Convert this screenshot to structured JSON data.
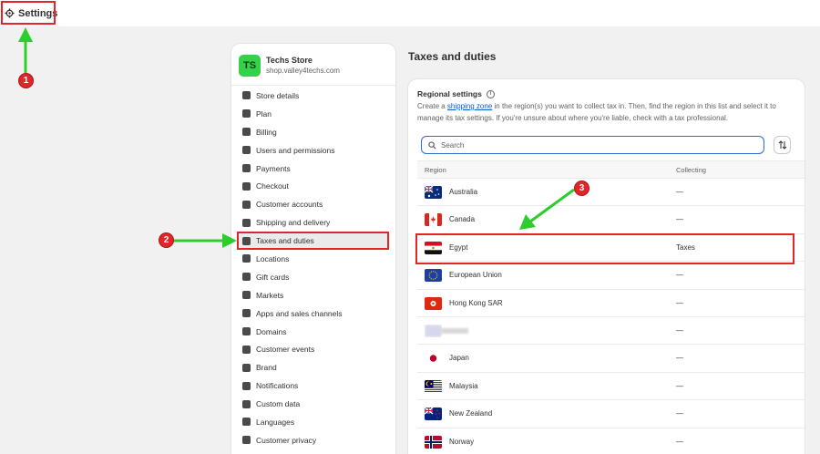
{
  "header": {
    "title": "Settings",
    "icon": "gear-icon"
  },
  "annotations": {
    "step1": "1",
    "step2": "2",
    "step3": "3",
    "color": "#e0262b",
    "arrow_color": "#2ecc2e"
  },
  "store": {
    "initials": "TS",
    "name": "Techs Store",
    "url": "shop.valley4techs.com",
    "avatar_color": "#35d14b"
  },
  "sidebar": {
    "items": [
      {
        "label": "Store details",
        "icon": "store-icon"
      },
      {
        "label": "Plan",
        "icon": "plan-icon"
      },
      {
        "label": "Billing",
        "icon": "billing-icon"
      },
      {
        "label": "Users and permissions",
        "icon": "users-icon"
      },
      {
        "label": "Payments",
        "icon": "payments-icon"
      },
      {
        "label": "Checkout",
        "icon": "checkout-icon"
      },
      {
        "label": "Customer accounts",
        "icon": "customer-icon"
      },
      {
        "label": "Shipping and delivery",
        "icon": "truck-icon"
      },
      {
        "label": "Taxes and duties",
        "icon": "tax-icon",
        "active": true
      },
      {
        "label": "Locations",
        "icon": "location-icon"
      },
      {
        "label": "Gift cards",
        "icon": "gift-icon"
      },
      {
        "label": "Markets",
        "icon": "globe-icon"
      },
      {
        "label": "Apps and sales channels",
        "icon": "apps-icon"
      },
      {
        "label": "Domains",
        "icon": "domain-icon"
      },
      {
        "label": "Customer events",
        "icon": "events-icon"
      },
      {
        "label": "Brand",
        "icon": "brand-icon"
      },
      {
        "label": "Notifications",
        "icon": "bell-icon"
      },
      {
        "label": "Custom data",
        "icon": "data-icon"
      },
      {
        "label": "Languages",
        "icon": "language-icon"
      },
      {
        "label": "Customer privacy",
        "icon": "privacy-icon"
      }
    ]
  },
  "main": {
    "title": "Taxes and duties",
    "card": {
      "heading": "Regional settings",
      "desc_before": "Create a ",
      "desc_link": "shipping zone",
      "desc_after": " in the region(s) you want to collect tax in. Then, find the region in this list and select it to manage its tax settings. If you're unsure about where you're liable, check with a tax professional.",
      "search_placeholder": "Search",
      "col_region": "Region",
      "col_collecting": "Collecting",
      "rows": [
        {
          "name": "Australia",
          "collecting": "—",
          "flag": "australia"
        },
        {
          "name": "Canada",
          "collecting": "—",
          "flag": "canada"
        },
        {
          "name": "Egypt",
          "collecting": "Taxes",
          "flag": "egypt"
        },
        {
          "name": "European Union",
          "collecting": "—",
          "flag": "eu"
        },
        {
          "name": "Hong Kong SAR",
          "collecting": "—",
          "flag": "hongkong"
        },
        {
          "name": "",
          "collecting": "—",
          "flag": "blurred"
        },
        {
          "name": "Japan",
          "collecting": "—",
          "flag": "japan"
        },
        {
          "name": "Malaysia",
          "collecting": "—",
          "flag": "malaysia"
        },
        {
          "name": "New Zealand",
          "collecting": "—",
          "flag": "newzealand"
        },
        {
          "name": "Norway",
          "collecting": "—",
          "flag": "norway"
        }
      ]
    }
  }
}
